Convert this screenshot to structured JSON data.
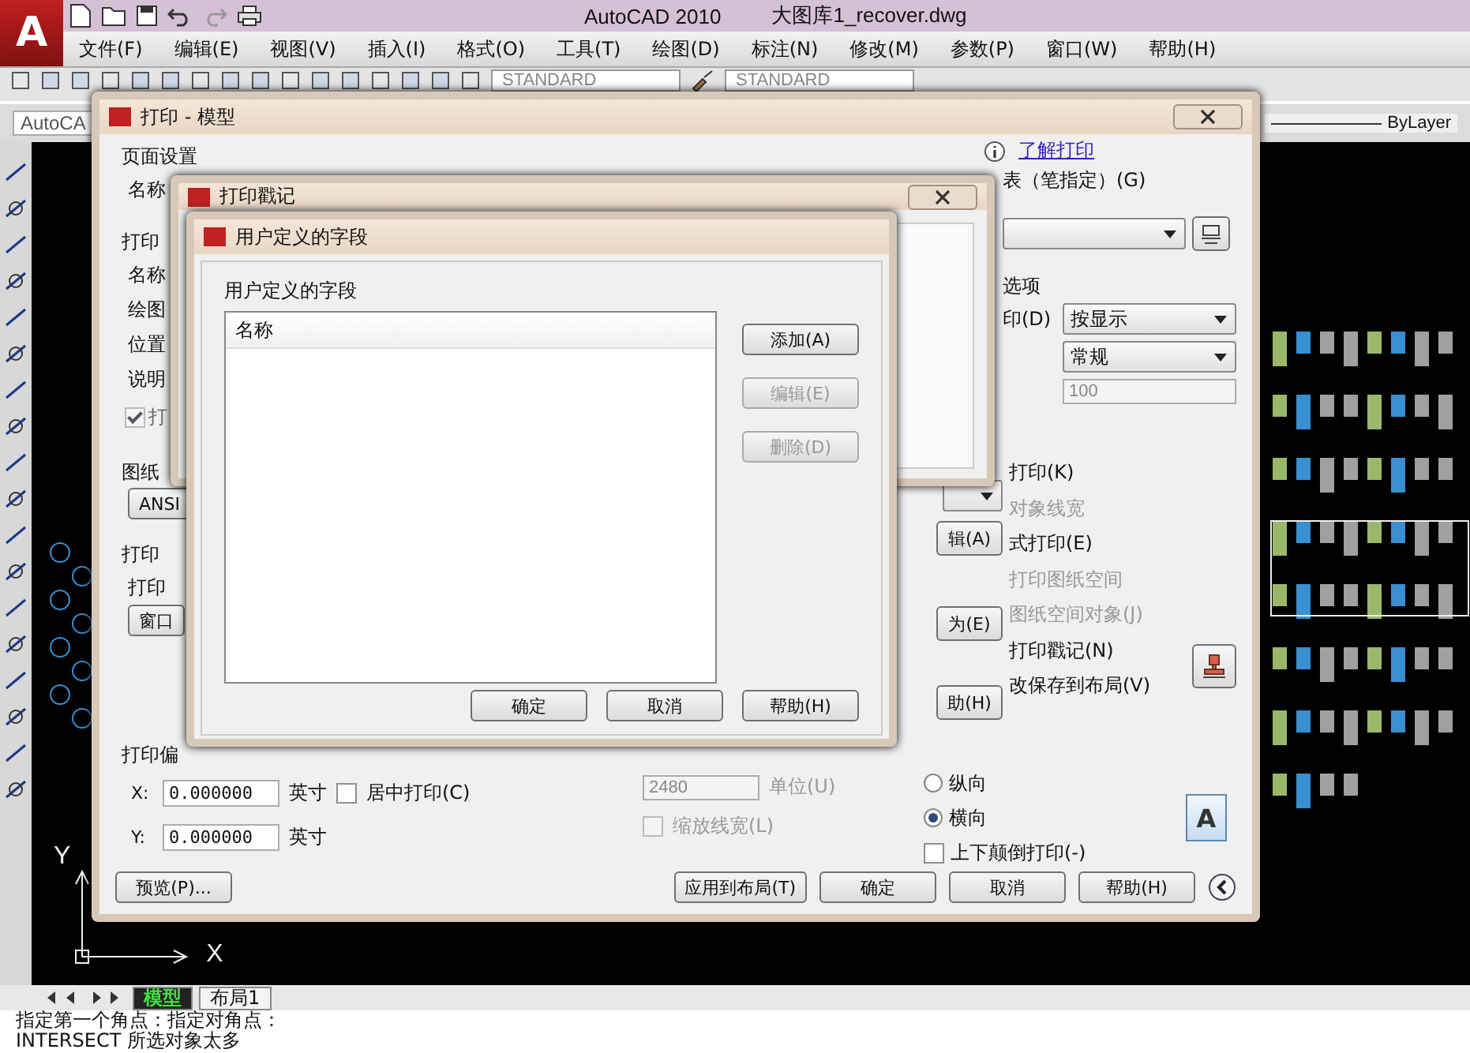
{
  "app": {
    "logo": "A",
    "title": "AutoCAD 2010",
    "file": "大图库1_recover.dwg"
  },
  "menu": [
    "文件(F)",
    "编辑(E)",
    "视图(V)",
    "插入(I)",
    "格式(O)",
    "工具(T)",
    "绘图(D)",
    "标注(N)",
    "修改(M)",
    "参数(P)",
    "窗口(W)",
    "帮助(H)"
  ],
  "toolbar": {
    "text_style": "STANDARD",
    "dim_style": "STANDARD"
  },
  "properties_bar": {
    "workspace": "AutoCA",
    "linetype": "ByLayer"
  },
  "plot_dialog": {
    "title": "打印 - 模型",
    "help_link": "了解打印",
    "left": [
      {
        "kind": "group",
        "text": "页面设置"
      },
      {
        "kind": "label",
        "text": "名称"
      },
      {
        "kind": "group",
        "text": "打印"
      },
      {
        "kind": "label",
        "text": "名称"
      },
      {
        "kind": "label",
        "text": "绘图"
      },
      {
        "kind": "label",
        "text": "位置"
      },
      {
        "kind": "label",
        "text": "说明"
      },
      {
        "kind": "checkbox",
        "text": "打",
        "checked": true
      },
      {
        "kind": "group",
        "text": "图纸"
      },
      {
        "kind": "button",
        "text": "ANSI"
      },
      {
        "kind": "group",
        "text": "打印"
      },
      {
        "kind": "label",
        "text": "打印"
      },
      {
        "kind": "button",
        "text": "窗口"
      }
    ],
    "offset": {
      "title": "打印偏",
      "x_label": "X:",
      "x_value": "0.000000",
      "x_unit": "英寸",
      "y_label": "Y:",
      "y_value": "0.000000",
      "y_unit": "英寸",
      "center": {
        "text": "居中打印(C)",
        "checked": false
      }
    },
    "scale": {
      "value": "2480",
      "unit": "单位(U)",
      "lineweight": {
        "text": "缩放线宽(L)",
        "checked": false
      }
    },
    "style_table": {
      "label": "表（笔指定）(G)"
    },
    "shaded": {
      "title": "选项",
      "quality_label": "印(D)",
      "mode": "按显示",
      "quality": "常规",
      "dpi": "100"
    },
    "fragment_buttons": [
      "辑(A)",
      "为(E)",
      "助(H)"
    ],
    "options": [
      {
        "text": "打印(K)",
        "disabled": false
      },
      {
        "text": "对象线宽",
        "disabled": true
      },
      {
        "text": "式打印(E)",
        "disabled": false
      },
      {
        "text": "打印图纸空间",
        "disabled": true
      },
      {
        "text": "图纸空间对象(J)",
        "disabled": true
      },
      {
        "text": "打印戳记(N)",
        "disabled": false
      },
      {
        "text": "改保存到布局(V)",
        "disabled": false
      }
    ],
    "orientation": [
      {
        "text": "纵向",
        "selected": false
      },
      {
        "text": "横向",
        "selected": true
      }
    ],
    "orientation_preview": "A",
    "upside_down": {
      "text": "上下颠倒打印(-)",
      "checked": false
    },
    "preview_button": "预览(P)...",
    "buttons": [
      "应用到布局(T)",
      "确定",
      "取消",
      "帮助(H)"
    ]
  },
  "stamp_dialog": {
    "title": "打印戳记"
  },
  "fields_dialog": {
    "title": "用户定义的字段",
    "group": "用户定义的字段",
    "column": "名称",
    "side_buttons": [
      {
        "text": "添加(A)",
        "disabled": false
      },
      {
        "text": "编辑(E)",
        "disabled": true
      },
      {
        "text": "删除(D)",
        "disabled": true
      }
    ],
    "buttons": [
      "确定",
      "取消",
      "帮助(H)"
    ]
  },
  "canvas": {
    "y_axis": "Y",
    "x_axis": "X"
  },
  "layout_tabs": [
    {
      "text": "模型",
      "selected": true
    },
    {
      "text": "布局1",
      "selected": false
    }
  ],
  "command_lines": [
    "指定第一个角点：指定对角点：",
    "INTERSECT 所选对象太多"
  ]
}
